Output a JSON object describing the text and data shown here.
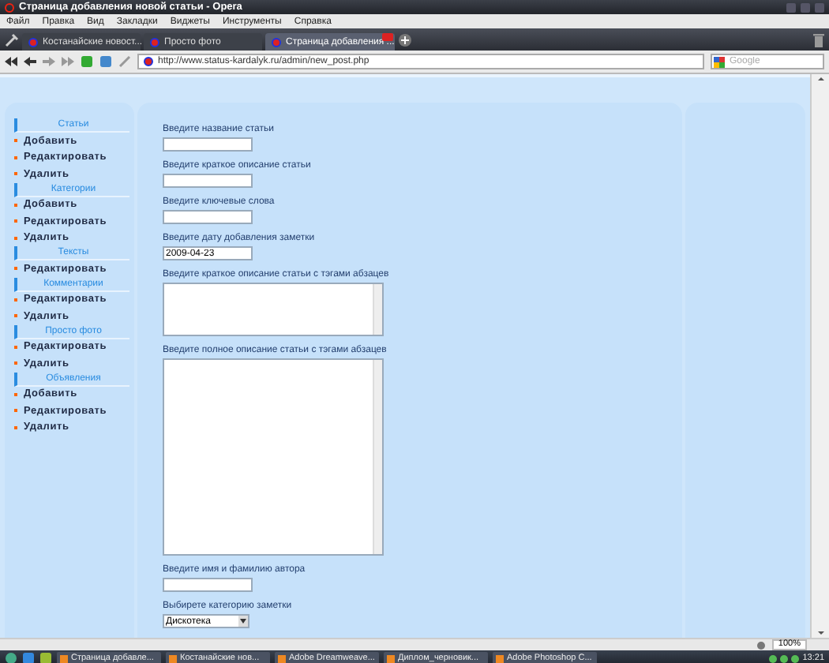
{
  "window": {
    "title": "Страница добавления новой статьи - Opera"
  },
  "menu": [
    "Файл",
    "Правка",
    "Вид",
    "Закладки",
    "Виджеты",
    "Инструменты",
    "Справка"
  ],
  "tabs": [
    {
      "label": "Костанайские новост...",
      "selected": false
    },
    {
      "label": "Просто фото",
      "selected": false
    },
    {
      "label": "Страница добавления ...",
      "selected": true
    }
  ],
  "address": "http://www.status-kardalyk.ru/admin/new_post.php",
  "search": {
    "placeholder": "Google"
  },
  "sidebar": [
    {
      "title": "Статьи",
      "items": [
        "Добавить",
        "Редактировать",
        "Удалить"
      ]
    },
    {
      "title": "Категории",
      "items": [
        "Добавить",
        "Редактировать",
        "Удалить"
      ]
    },
    {
      "title": "Тексты",
      "items": [
        "Редактировать"
      ]
    },
    {
      "title": "Комментарии",
      "items": [
        "Редактировать",
        "Удалить"
      ]
    },
    {
      "title": "Просто фото",
      "items": [
        "Редактировать",
        "Удалить"
      ]
    },
    {
      "title": "Объявления",
      "items": [
        "Добавить",
        "Редактировать",
        "Удалить"
      ]
    }
  ],
  "form": [
    {
      "kind": "input",
      "label": "Введите название статьи"
    },
    {
      "kind": "input",
      "label": "Введите краткое описание статьи"
    },
    {
      "kind": "input",
      "label": "Введите ключевые слова"
    },
    {
      "kind": "input",
      "label": "Введите дату добавления заметки",
      "value": "2009-04-23"
    },
    {
      "kind": "short-textarea",
      "label": "Введите краткое описание статьи с тэгами абзацев"
    },
    {
      "kind": "long-textarea",
      "label": "Введите полное описание статьи с тэгами абзацев"
    },
    {
      "kind": "input",
      "label": "Введите имя и фамилию автора"
    },
    {
      "kind": "select",
      "label": "Выбирете категорию заметки",
      "value": "Дискотека"
    }
  ],
  "status_bar": {
    "zoom": "100%"
  },
  "taskbar": {
    "items": [
      "Страница добавле...",
      "Костанайские нов...",
      "Adobe Dreamweave...",
      "Диплом_черновик...",
      "Adobe Photoshop C..."
    ],
    "clock": "13:21"
  }
}
